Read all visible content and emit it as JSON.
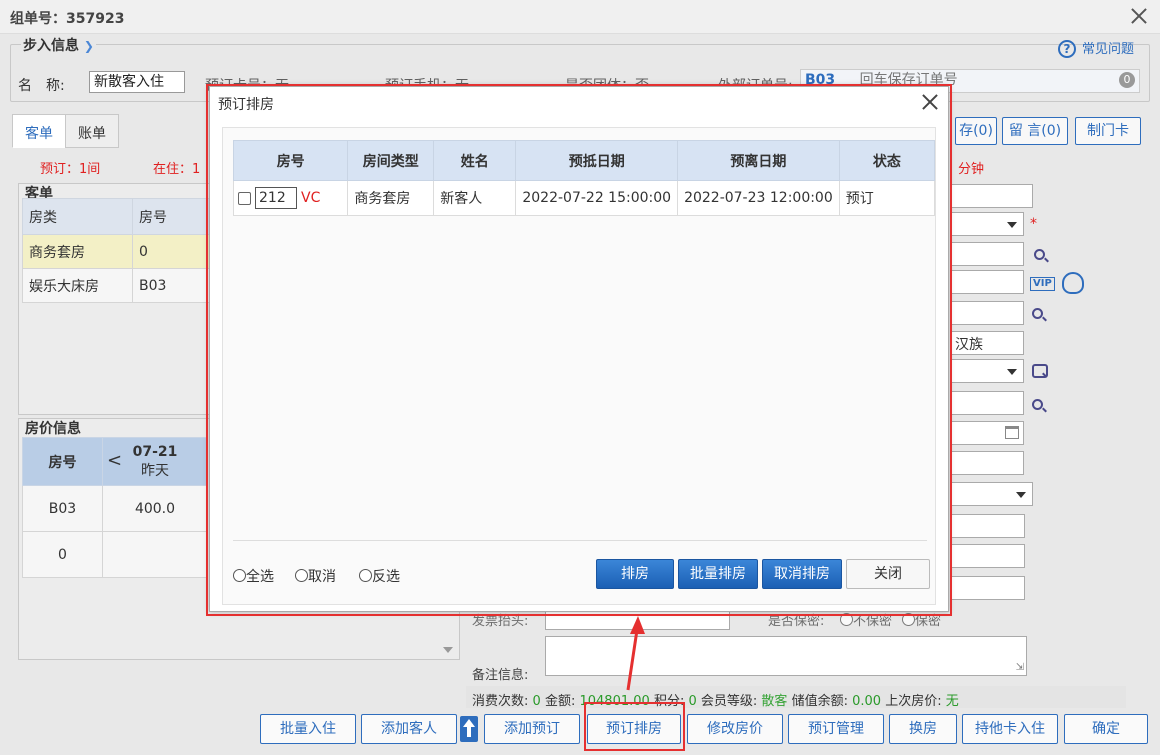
{
  "window": {
    "title": "组单号：357923"
  },
  "step": {
    "legend": "步入信息",
    "help": "常见问题",
    "name_label": "名　称:",
    "name_value": "新散客入住",
    "card_label": "预订卡号：无",
    "phone_label": "预订手机：无",
    "team_label": "是否团体：否",
    "external_label": "外部订单号:",
    "external_value": "B03",
    "external_placeholder": "回车保存订单号"
  },
  "tabs": [
    "客单",
    "账单"
  ],
  "top_buttons": [
    "存(0)",
    "留 言(0)",
    "制门卡"
  ],
  "status_line": {
    "booked": "预订：1间",
    "inhouse": "在住：1",
    "minutes": "分钟"
  },
  "guest_panel": {
    "title": "客单",
    "headers": [
      "房类",
      "房号"
    ],
    "rows": [
      [
        "商务套房",
        "0"
      ],
      [
        "娱乐大床房",
        "B03"
      ]
    ]
  },
  "price_panel": {
    "title": "房价信息",
    "col_room": "房号",
    "date": "07-21",
    "date_sub": "昨天",
    "rows": [
      [
        "B03",
        "400.0"
      ],
      [
        "0",
        ""
      ]
    ]
  },
  "right_form": {
    "ethnic": "汉族",
    "invoice_label": "发票抬头:",
    "deposit_label": "是否保密:",
    "opt_no": "不保密",
    "opt_yes": "保密",
    "note_label": "备注信息:"
  },
  "stats": {
    "count_label": "消费次数:",
    "count": "0",
    "amount_label": "金额:",
    "amount": "104801.00",
    "points_label": "积分:",
    "points": "0",
    "level_label": "会员等级:",
    "level": "散客",
    "balance_label": "储值余额:",
    "balance": "0.00",
    "last_label": "上次房价:",
    "last": "无"
  },
  "bottom_buttons": [
    "批量入住",
    "添加客人",
    "添加预订",
    "预订排房",
    "修改房价",
    "预订管理",
    "换房",
    "持他卡入住",
    "确定"
  ],
  "modal": {
    "title": "预订排房",
    "headers": [
      "房号",
      "房间类型",
      "姓名",
      "预抵日期",
      "预离日期",
      "状态"
    ],
    "rows": [
      {
        "room": "212",
        "tag": "VC",
        "type": "商务套房",
        "name": "新客人",
        "arrive": "2022-07-22 15:00:00",
        "leave": "2022-07-23 12:00:00",
        "status": "预订"
      }
    ],
    "radios": [
      "全选",
      "取消",
      "反选"
    ],
    "buttons": {
      "assign": "排房",
      "batch": "批量排房",
      "cancel": "取消排房",
      "close": "关闭"
    }
  },
  "colors": {
    "accent": "#2e6dbd",
    "highlight_red": "#e53030",
    "header_blue": "#d7e3f3"
  }
}
